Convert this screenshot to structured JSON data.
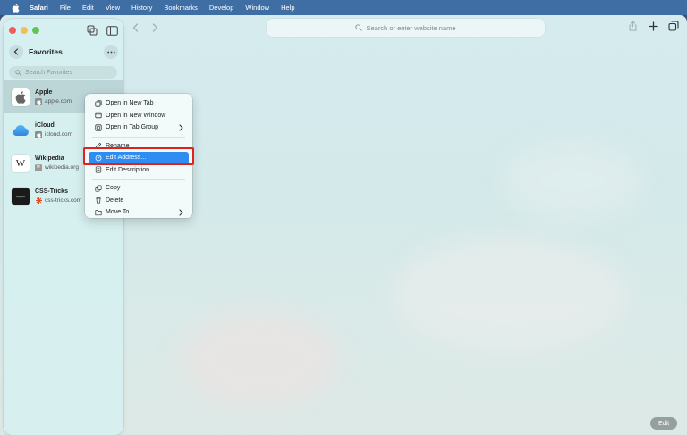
{
  "menubar": {
    "apple_icon": "apple-logo-icon",
    "items": [
      "Safari",
      "File",
      "Edit",
      "View",
      "History",
      "Bookmarks",
      "Develop",
      "Window",
      "Help"
    ]
  },
  "sidebar": {
    "title": "Favorites",
    "search_placeholder": "Search Favorites",
    "favorites": [
      {
        "name": "Apple",
        "url": "apple.com",
        "icon": "apple-logo-icon",
        "selected": true
      },
      {
        "name": "iCloud",
        "url": "icloud.com",
        "icon": "cloud-icon"
      },
      {
        "name": "Wikipedia",
        "url": "wikipedia.org",
        "icon": "wikipedia-w-icon"
      },
      {
        "name": "CSS-Tricks",
        "url": "css-tricks.com",
        "icon": "css-tricks-icon"
      }
    ]
  },
  "toolbar": {
    "address_placeholder": "Search or enter website name"
  },
  "context_menu": {
    "items": [
      {
        "label": "Open in New Tab",
        "icon": "new-tab-icon"
      },
      {
        "label": "Open in New Window",
        "icon": "new-window-icon"
      },
      {
        "label": "Open in Tab Group",
        "icon": "tab-group-icon",
        "submenu": true
      },
      {
        "label": "Rename",
        "icon": "pencil-icon"
      },
      {
        "label": "Edit Address...",
        "icon": "edit-address-icon",
        "highlighted": true
      },
      {
        "label": "Edit Description...",
        "icon": "edit-description-icon"
      },
      {
        "label": "Copy",
        "icon": "copy-icon"
      },
      {
        "label": "Delete",
        "icon": "trash-icon"
      },
      {
        "label": "Move To",
        "icon": "folder-icon",
        "submenu": true
      }
    ]
  },
  "footer": {
    "edit_label": "Edit"
  },
  "colors": {
    "menubar": "#3f6ea4",
    "highlight": "#2f8cf0",
    "annotation_box": "#e0211c"
  }
}
